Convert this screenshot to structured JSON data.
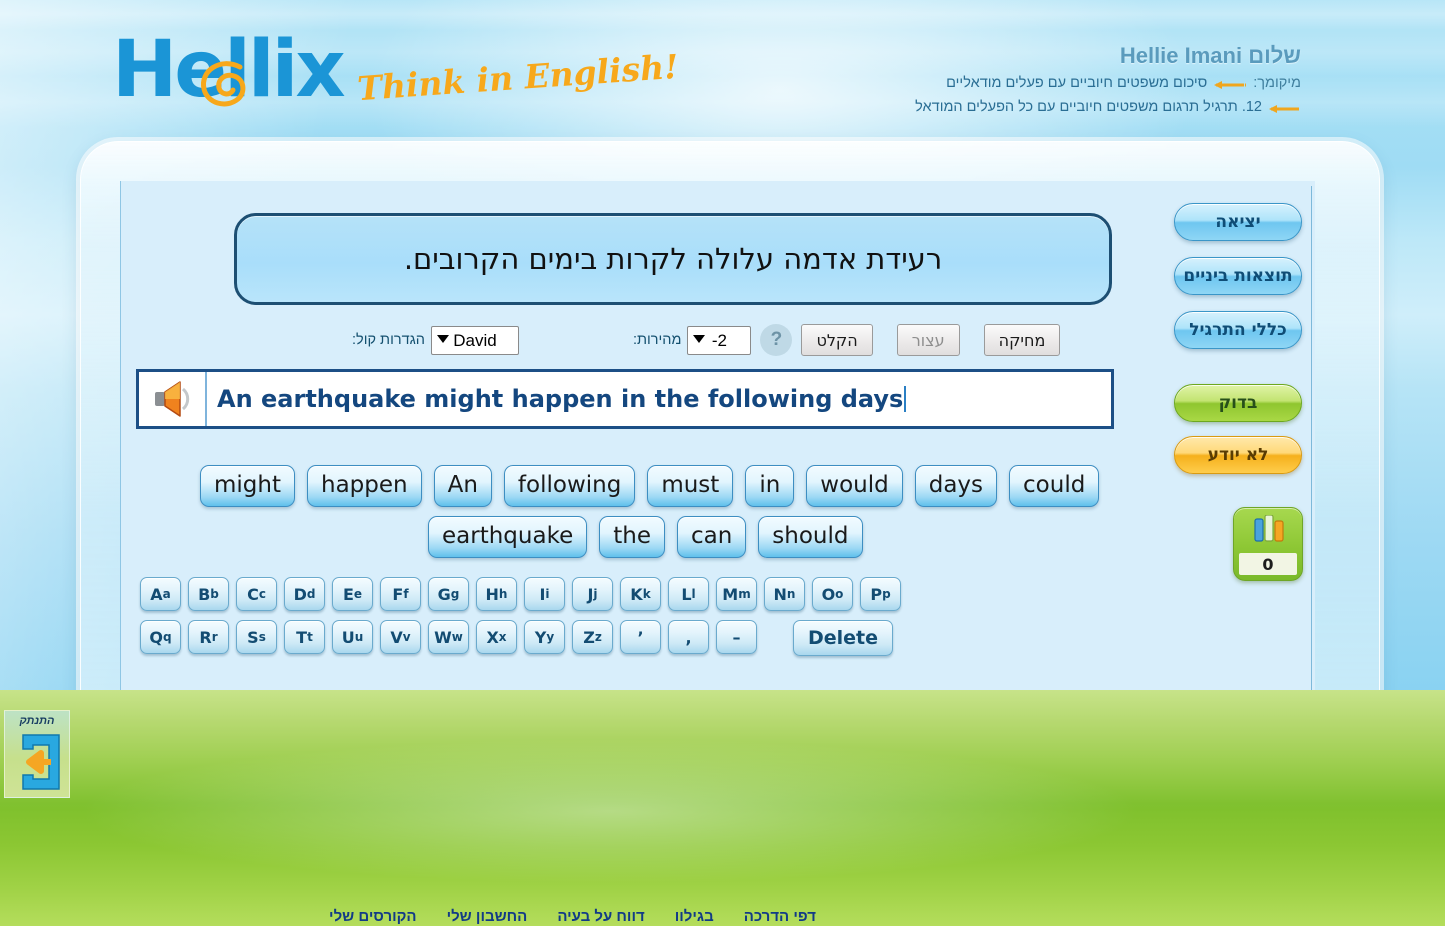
{
  "brand": {
    "logo_text": "Hellix",
    "tagline": "Think in English!",
    "logo_color": "#1b95d6",
    "tagline_color": "#f7a81b"
  },
  "header": {
    "greeting": "שלום Hellie Imani",
    "location_label": "מיקומך:",
    "location_line1": "סיכום משפטים חיוביים עם פעלים מודאליים",
    "location_line2": "12. תרגיל תרגום משפטים חיוביים עם כל הפעלים המודאל"
  },
  "exercise": {
    "prompt_sentence": "רעידת אדמה עלולה לקרות בימים הקרובים.",
    "answer_text": "An earthquake might happen in the following days"
  },
  "toolbar": {
    "voice_label": "הגדרות קול:",
    "voice_value": "David",
    "voice_options": [
      "David"
    ],
    "speed_label": "מהירות:",
    "speed_value": "-2",
    "speed_options": [
      "-2"
    ],
    "help_glyph": "?",
    "record_label": "הקלט",
    "stop_label": "עצור",
    "erase_label": "מחיקה"
  },
  "word_tiles": {
    "row1": [
      "might",
      "happen",
      "An",
      "following",
      "must",
      "in",
      "would",
      "days",
      "could"
    ],
    "row2": [
      "earthquake",
      "the",
      "can",
      "should"
    ]
  },
  "keyboard": {
    "row1": [
      {
        "upper": "A",
        "lower": "a"
      },
      {
        "upper": "B",
        "lower": "b"
      },
      {
        "upper": "C",
        "lower": "c"
      },
      {
        "upper": "D",
        "lower": "d"
      },
      {
        "upper": "E",
        "lower": "e"
      },
      {
        "upper": "F",
        "lower": "f"
      },
      {
        "upper": "G",
        "lower": "g"
      },
      {
        "upper": "H",
        "lower": "h"
      },
      {
        "upper": "I",
        "lower": "i"
      },
      {
        "upper": "J",
        "lower": "j"
      },
      {
        "upper": "K",
        "lower": "k"
      },
      {
        "upper": "L",
        "lower": "l"
      },
      {
        "upper": "M",
        "lower": "m"
      },
      {
        "upper": "N",
        "lower": "n"
      },
      {
        "upper": "O",
        "lower": "o"
      },
      {
        "upper": "P",
        "lower": "p"
      }
    ],
    "row2": [
      {
        "upper": "Q",
        "lower": "q"
      },
      {
        "upper": "R",
        "lower": "r"
      },
      {
        "upper": "S",
        "lower": "s"
      },
      {
        "upper": "T",
        "lower": "t"
      },
      {
        "upper": "U",
        "lower": "u"
      },
      {
        "upper": "V",
        "lower": "v"
      },
      {
        "upper": "W",
        "lower": "w"
      },
      {
        "upper": "X",
        "lower": "x"
      },
      {
        "upper": "Y",
        "lower": "y"
      },
      {
        "upper": "Z",
        "lower": "z"
      }
    ],
    "punctuation": [
      "’",
      ",",
      "–"
    ],
    "delete_label": "Delete"
  },
  "sidebar": {
    "exit_label": "יציאה",
    "interim_results_label": "תוצאות ביניים",
    "exercise_rules_label": "כללי התרגיל",
    "check_label": "בדוק",
    "dont_know_label": "לא יודע",
    "score_value": "0"
  },
  "logout": {
    "label": "התנתק"
  },
  "bottom_nav": [
    "הקורסים שלי",
    "החשבון שלי",
    "דווח על בעיה",
    "בגילוו",
    "דפי הדרכה"
  ]
}
